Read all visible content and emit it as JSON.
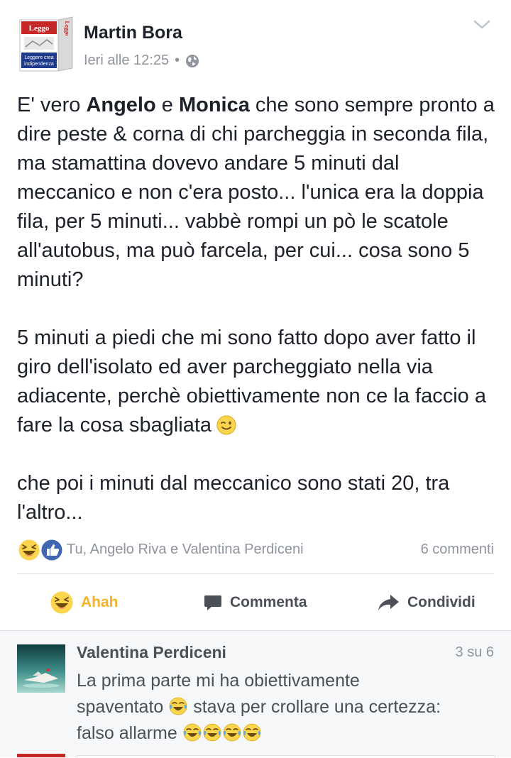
{
  "post": {
    "author": "Martin Bora",
    "avatar_brand": "Leggo",
    "avatar_tagline_1": "Leggere crea",
    "avatar_tagline_2": "indipendenza",
    "timestamp": "Ieri alle 12:25",
    "separator": "•",
    "privacy_icon": "globe-icon",
    "paragraph1": {
      "t1": "E' vero ",
      "mention1": "Angelo",
      "t2": " e ",
      "mention2": "Monica",
      "t3": " che sono sempre pronto a dire peste & corna di chi parcheggia in seconda fila, ma stamattina dovevo andare 5 minuti dal meccanico e non c'era posto... l'unica era la doppia fila, per 5 minuti... vabbè rompi un pò le scatole all'autobus, ma può farcela, per cui... cosa sono 5 minuti?"
    },
    "paragraph2": "5 minuti a piedi che mi sono fatto dopo aver fatto il giro dell'isolato ed aver parcheggiato nella via adiacente, perchè obiettivamente non ce la faccio a fare la cosa sbagliata",
    "paragraph3": "che poi i minuti dal meccanico sono stati 20, tra l'altro...",
    "reactions_summary": "Tu, Angelo Riva e Valentina Perdiceni",
    "comments_count": "6 commenti",
    "actions": {
      "react_label": "Ahah",
      "comment_label": "Commenta",
      "share_label": "Condividi"
    }
  },
  "comment": {
    "author": "Valentina Perdiceni",
    "pager": "3 su 6",
    "line1": "La prima parte mi ha obiettivamente",
    "line2a": "spaventato",
    "line2b": "stava per crollare una certezza:",
    "line3": "falso allarme"
  },
  "colors": {
    "ahah": "#f7b125",
    "like_blue": "#4267b2",
    "meta_gray": "#90949c",
    "comment_bg": "#f6f7f9"
  }
}
